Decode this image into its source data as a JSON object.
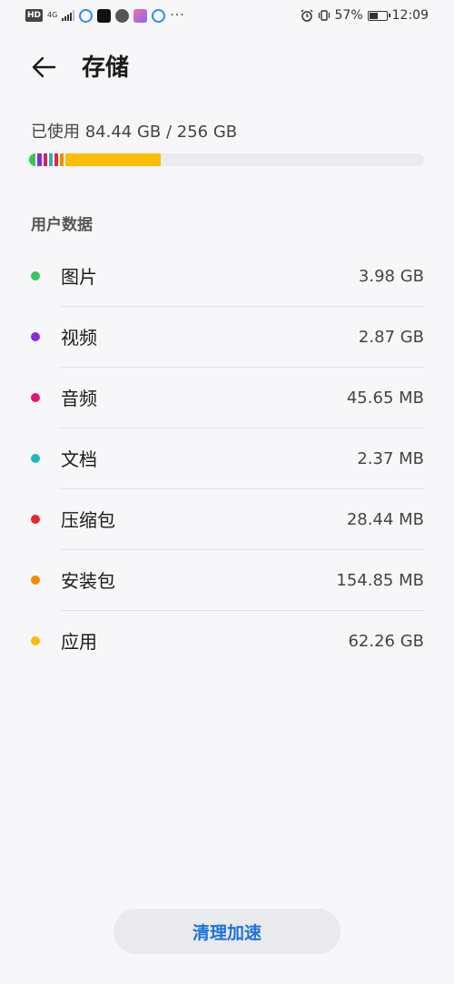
{
  "status_bar": {
    "hd": "HD",
    "network": "4G",
    "battery": "57%",
    "battery_level": 0.57,
    "time": "12:09"
  },
  "header": {
    "title": "存储"
  },
  "storage": {
    "used_label": "已使用 84.44 GB / 256 GB",
    "used_gb": 84.44,
    "total_gb": 256
  },
  "section": {
    "title": "用户数据"
  },
  "categories": [
    {
      "name": "图片",
      "size": "3.98 GB",
      "color": "#34c759"
    },
    {
      "name": "视频",
      "size": "2.87 GB",
      "color": "#8a2be2"
    },
    {
      "name": "音频",
      "size": "45.65 MB",
      "color": "#e0186c"
    },
    {
      "name": "文档",
      "size": "2.37 MB",
      "color": "#1fb5c2"
    },
    {
      "name": "压缩包",
      "size": "28.44 MB",
      "color": "#e8262f"
    },
    {
      "name": "安装包",
      "size": "154.85 MB",
      "color": "#f08c00"
    },
    {
      "name": "应用",
      "size": "62.26 GB",
      "color": "#fbbc04"
    }
  ],
  "actions": {
    "clean_label": "清理加速"
  }
}
